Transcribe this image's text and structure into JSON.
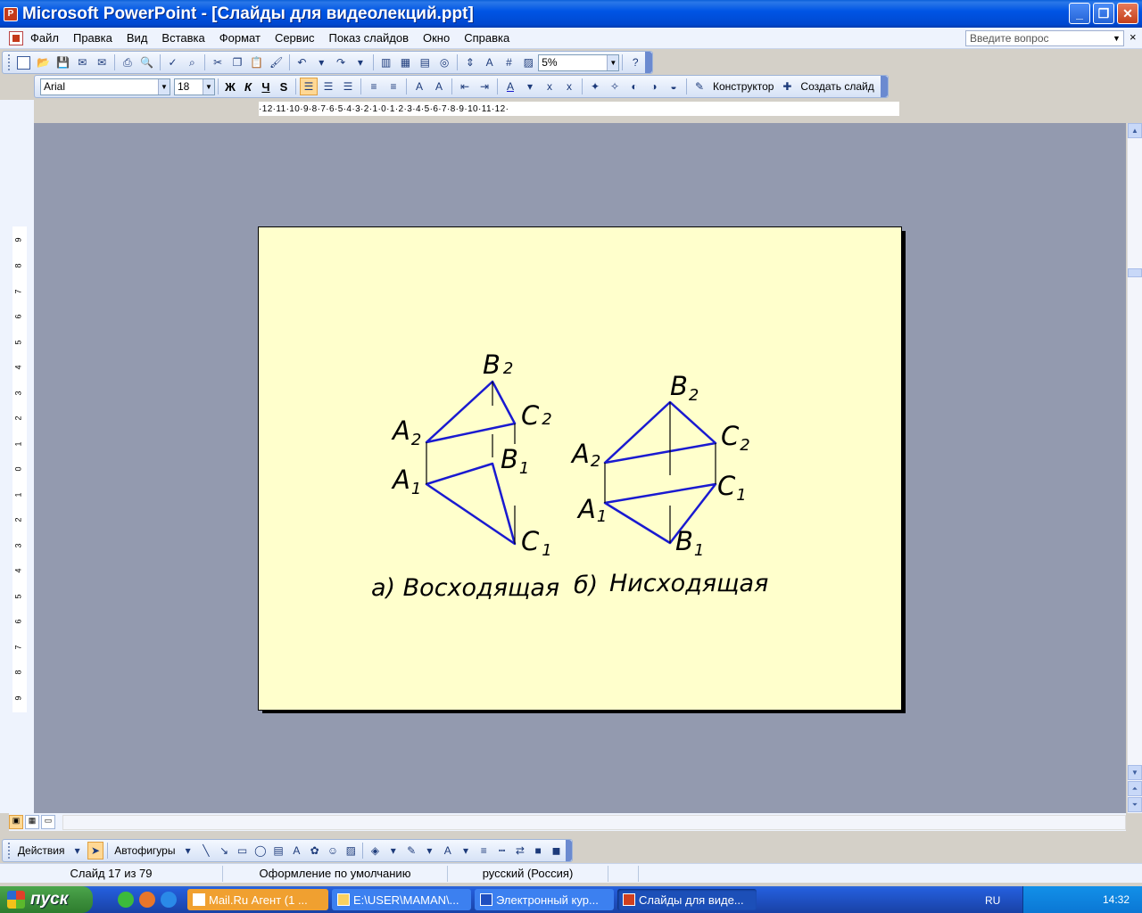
{
  "window": {
    "title": "Microsoft PowerPoint - [Слайды для видеолекций.ppt]",
    "minimize": "_",
    "maximize": "❐",
    "close": "✕"
  },
  "menu": {
    "items": [
      "Файл",
      "Правка",
      "Вид",
      "Вставка",
      "Формат",
      "Сервис",
      "Показ слайдов",
      "Окно",
      "Справка"
    ],
    "help_placeholder": "Введите вопрос",
    "close": "×"
  },
  "standard_toolbar": {
    "zoom": "5%"
  },
  "formatting_toolbar": {
    "font": "Arial",
    "size": "18",
    "bold": "Ж",
    "italic": "К",
    "underline": "Ч",
    "shadow": "S",
    "designer": "Конструктор",
    "new_slide": "Создать слайд"
  },
  "rulers": {
    "horizontal": "·12·11·10·9·8·7·6·5·4·3·2·1·0·1·2·3·4·5·6·7·8·9·10·11·12·",
    "vertical": [
      "9",
      "8",
      "7",
      "6",
      "5",
      "4",
      "3",
      "2",
      "1",
      "0",
      "1",
      "2",
      "3",
      "4",
      "5",
      "6",
      "7",
      "8",
      "9"
    ]
  },
  "slide": {
    "left_figure": {
      "labels": {
        "B2": "B",
        "B2_sub": "2",
        "C2": "C",
        "C2_sub": "2",
        "A2": "A",
        "A2_sub": "2",
        "A1": "A",
        "A1_sub": "1",
        "B1": "B",
        "B1_sub": "1",
        "C1": "C",
        "C1_sub": "1"
      },
      "caption": "а) Восходящая"
    },
    "right_figure": {
      "labels": {
        "B2": "B",
        "B2_sub": "2",
        "C2": "C",
        "C2_sub": "2",
        "A2": "A",
        "A2_sub": "2",
        "C1": "C",
        "C1_sub": "1",
        "A1": "A",
        "A1_sub": "1",
        "B1": "B",
        "B1_sub": "1"
      },
      "caption_prefix": "б)",
      "caption": "Нисходящая"
    },
    "line_color": "#1a1ad0"
  },
  "drawing_toolbar": {
    "actions": "Действия",
    "autoshapes": "Автофигуры"
  },
  "status": {
    "slide": "Слайд 17 из 79",
    "design": "Оформление по умолчанию",
    "language": "русский (Россия)"
  },
  "taskbar": {
    "start": "пуск",
    "tasks": [
      "Mail.Ru Агент (1 ...",
      "E:\\USER\\MAMAN\\...",
      "Электронный кур...",
      "Слайды для виде..."
    ],
    "lang": "RU",
    "time": "14:32"
  }
}
